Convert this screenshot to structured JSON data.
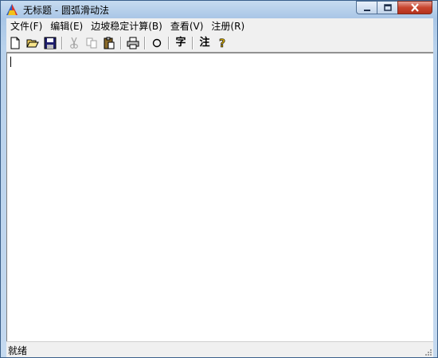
{
  "window": {
    "title": "无标题 - 圆弧滑动法"
  },
  "menu": [
    {
      "label": "文件(F)"
    },
    {
      "label": "编辑(E)"
    },
    {
      "label": "边坡稳定计算(B)"
    },
    {
      "label": "查看(V)"
    },
    {
      "label": "注册(R)"
    }
  ],
  "toolbar": {
    "text_button_label": "字",
    "note_button_label": "注"
  },
  "status": {
    "text": "就绪"
  }
}
